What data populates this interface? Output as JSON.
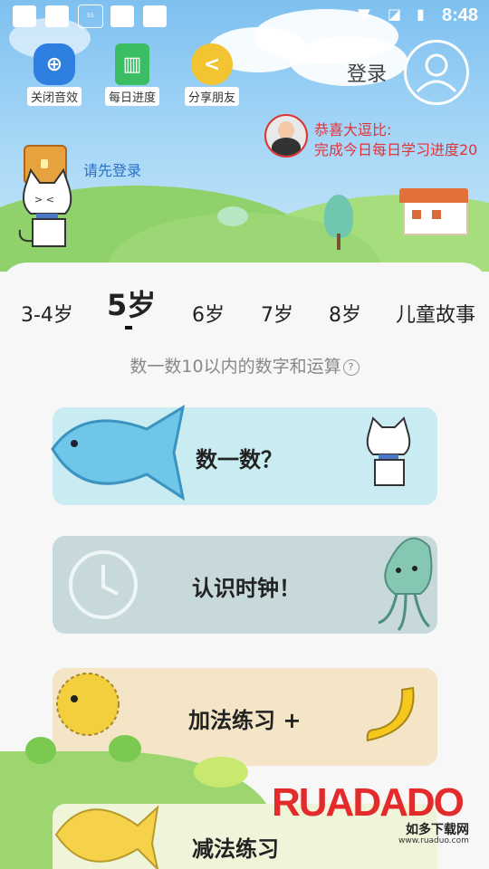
{
  "status_bar": {
    "time": "8:48"
  },
  "top_buttons": [
    {
      "label": "关闭音效",
      "icon": "gamepad-icon"
    },
    {
      "label": "每日进度",
      "icon": "book-icon"
    },
    {
      "label": "分享朋友",
      "icon": "share-coin-icon"
    }
  ],
  "header": {
    "login_label": "登录"
  },
  "notice": {
    "name": "恭喜大逗比:",
    "text": "完成今日每日学习进度20"
  },
  "chest": {
    "prompt": "请先登录"
  },
  "tabs": [
    "3-4岁",
    "5岁",
    "6岁",
    "7岁",
    "8岁",
    "儿童故事"
  ],
  "active_tab": "5岁",
  "subtitle": "数一数10以内的数字和运算",
  "cards": [
    {
      "label": "数一数？",
      "color": "#c9ecf2",
      "left_icon": "fish-icon",
      "right_icon": "cat-icon"
    },
    {
      "label": "认识时钟！",
      "color": "#c7d9db",
      "left_icon": "clock-icon",
      "right_icon": "squid-icon"
    },
    {
      "label": "加法练习 +",
      "color": "#f3e5c5",
      "left_icon": "pufferfish-icon",
      "right_icon": "banana-icon"
    },
    {
      "label": "减法练习",
      "color": "#eef5d8",
      "left_icon": "yellow-fish-icon",
      "right_icon": ""
    }
  ],
  "watermark": {
    "brand": "RUADADO",
    "sub": "如多下载网",
    "url": "www.ruaduo.com"
  }
}
